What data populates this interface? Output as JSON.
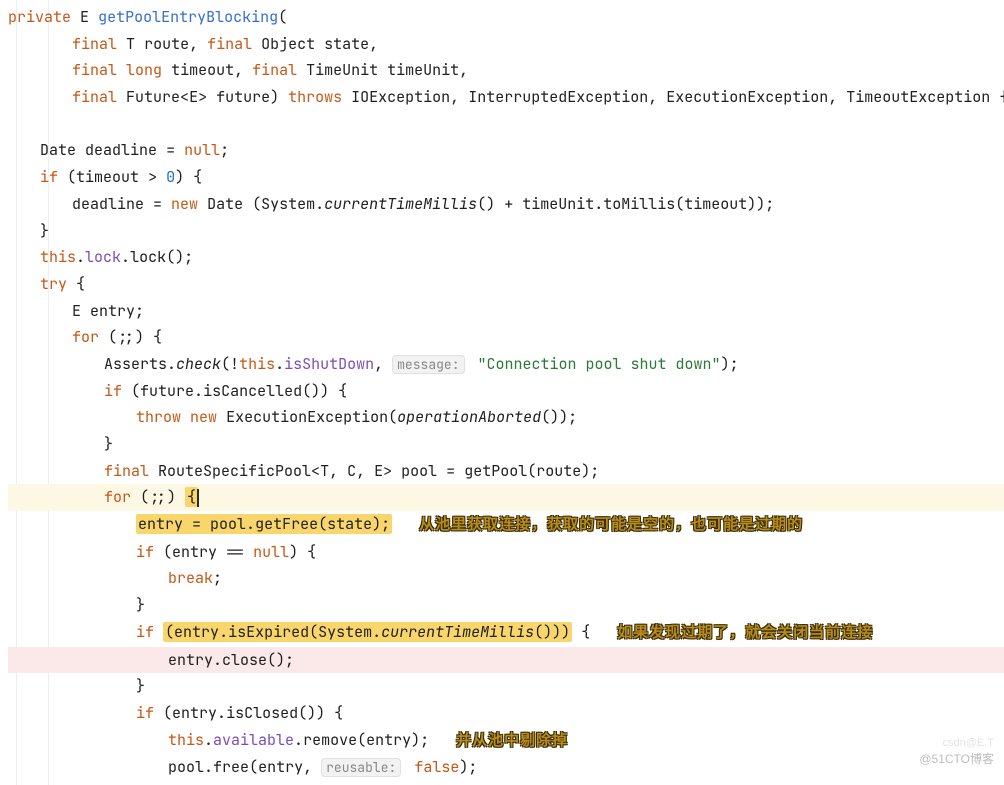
{
  "kw": {
    "private": "private",
    "final": "final",
    "long": "long",
    "if": "if",
    "new": "new",
    "this": "this",
    "try": "try",
    "for": "for",
    "throw": "throw",
    "break": "break",
    "null": "null",
    "throws": "throws",
    "false": "false"
  },
  "sig": {
    "generic_E": "E",
    "fn_name": "getPoolEntryBlocking",
    "T": "T",
    "route": "route",
    "Object": "Object",
    "state": "state",
    "timeout": "timeout",
    "TimeUnit": "TimeUnit",
    "timeUnit": "timeUnit",
    "Future": "Future",
    "E": "E",
    "future": "future",
    "IOException": "IOException",
    "InterruptedException": "InterruptedException",
    "ExecutionException": "ExecutionException",
    "TimeoutException": "TimeoutException"
  },
  "body": {
    "Date": "Date",
    "deadline": "deadline",
    "eq_null": " = ",
    "semi": ";",
    "gt0": " > ",
    "zero": "0",
    "System": "System",
    "currentTimeMillis": "currentTimeMillis",
    "plus": " + ",
    "toMillis": "toMillis",
    "lock_field": "lock",
    "lock_call": "lock",
    "entry": "entry",
    "Asserts": "Asserts",
    "check": "check",
    "isShutDown": "isShutDown",
    "msg_hint": "message:",
    "pool_msg": "\"Connection pool shut down\"",
    "isCancelled": "isCancelled",
    "ExecutionExceptionCtor": "ExecutionException",
    "operationAborted": "operationAborted",
    "RouteSpecificPool": "RouteSpecificPool",
    "T2": "T",
    "C": "C",
    "E2": "E",
    "pool": "pool",
    "getPool": "getPool",
    "getFree": "getFree",
    "eqeq_null": " == ",
    "isExpired": "isExpired",
    "close": "close",
    "isClosed": "isClosed",
    "available": "available",
    "remove": "remove",
    "free": "free",
    "reusable_hint": "reusable:"
  },
  "annot": {
    "a1": "从池里获取连接，获取的可能是空的，也可能是过期的",
    "a2": "如果发现过期了，就会关闭当前连接",
    "a3": "并从池中剔除掉"
  },
  "watermark": "@51CTO博客",
  "watermark2": "csdn@E.T"
}
